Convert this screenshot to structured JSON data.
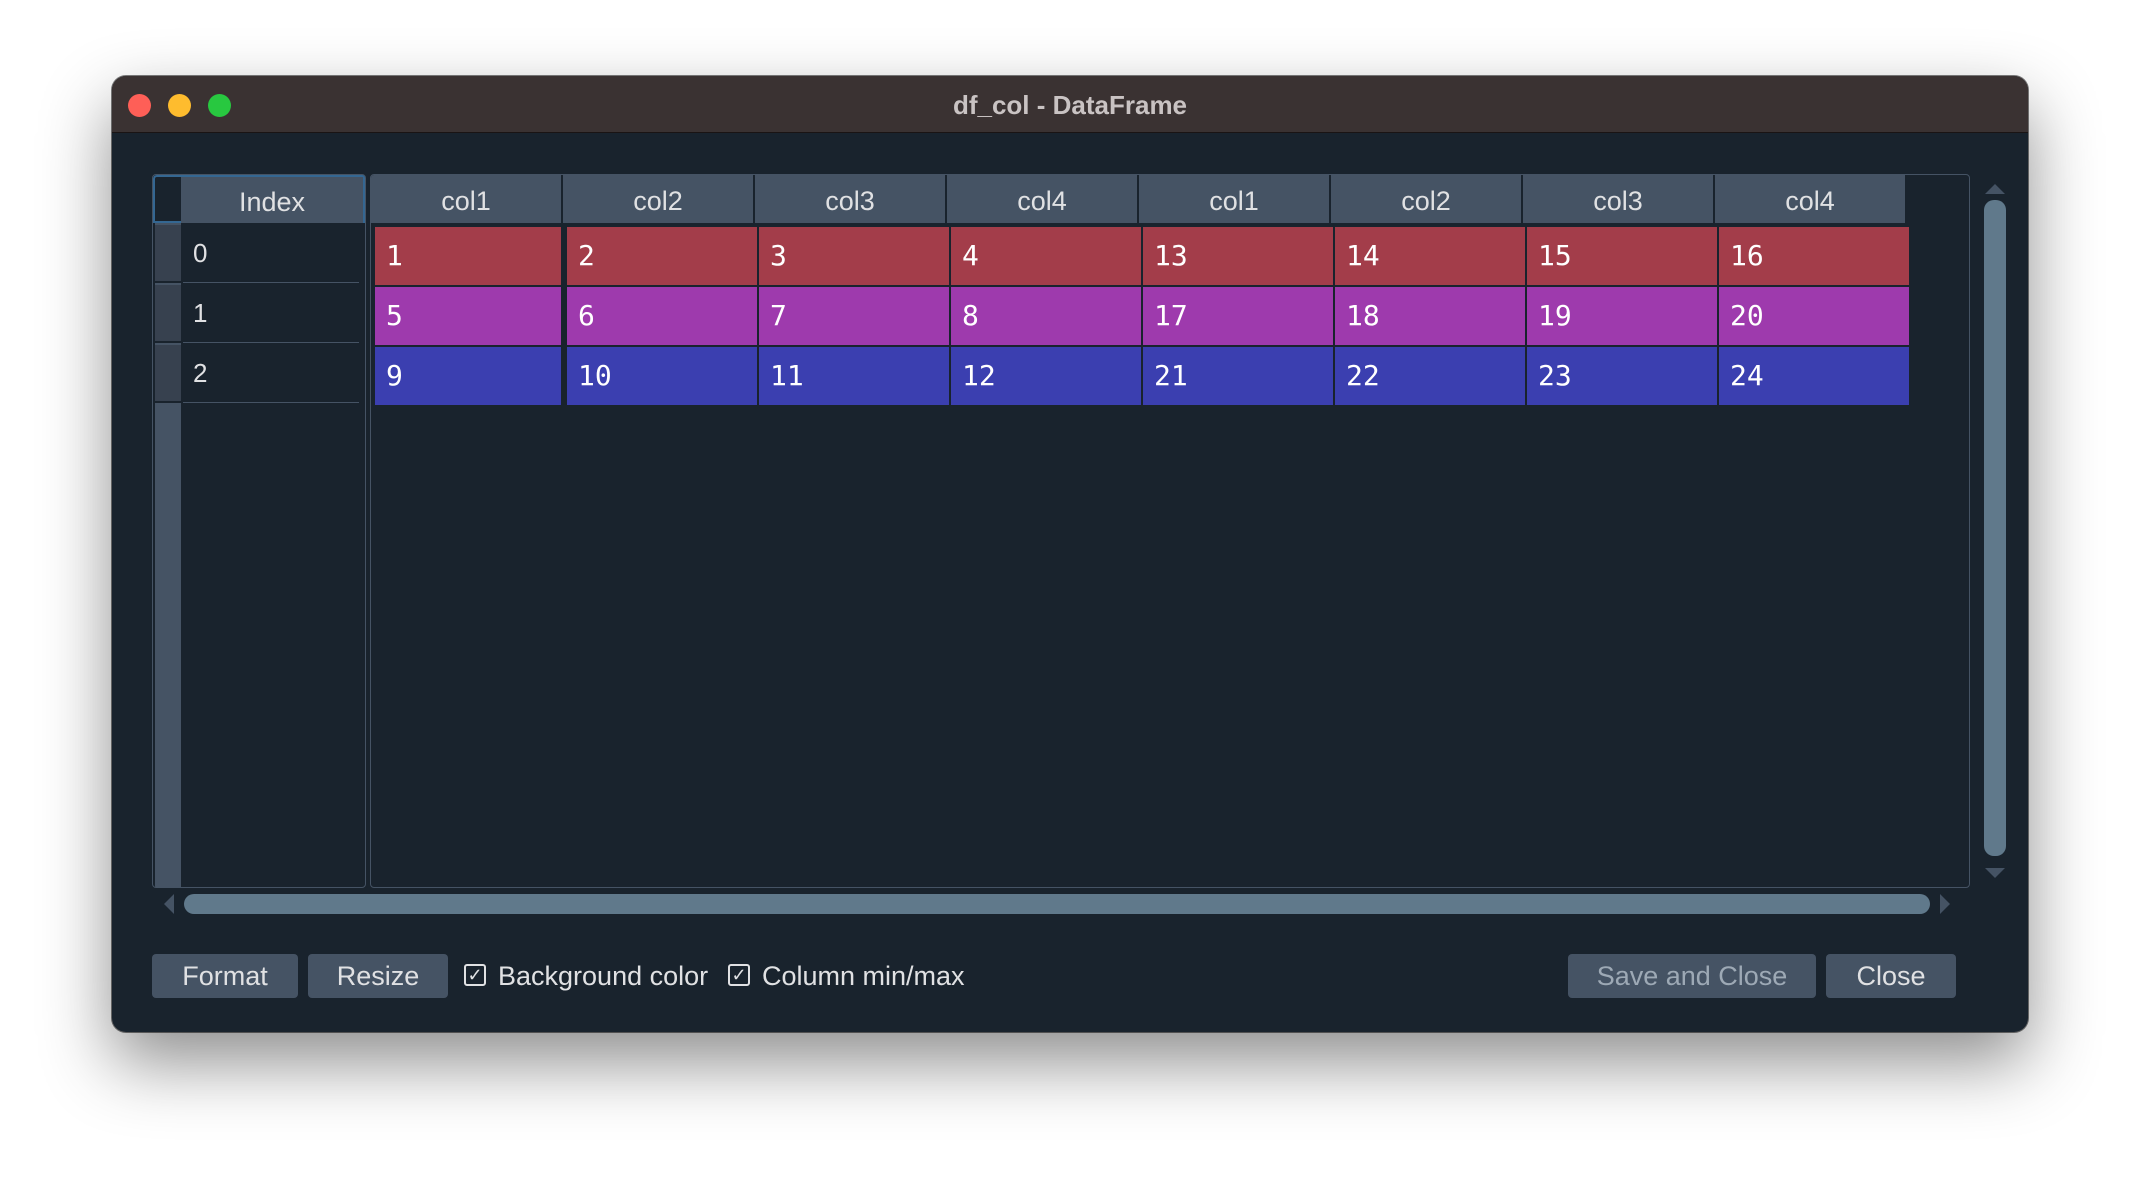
{
  "window": {
    "title": "df_col - DataFrame"
  },
  "table": {
    "index_header": "Index",
    "index": [
      "0",
      "1",
      "2"
    ],
    "columns": [
      "col1",
      "col2",
      "col3",
      "col4",
      "col1",
      "col2",
      "col3",
      "col4"
    ],
    "rows": [
      [
        "1",
        "2",
        "3",
        "4",
        "13",
        "14",
        "15",
        "16"
      ],
      [
        "5",
        "6",
        "7",
        "8",
        "17",
        "18",
        "19",
        "20"
      ],
      [
        "9",
        "10",
        "11",
        "12",
        "21",
        "22",
        "23",
        "24"
      ]
    ],
    "row_colors": [
      "#a33d4a",
      "#9e3aad",
      "#3b3fb0"
    ]
  },
  "buttons": {
    "format": "Format",
    "resize": "Resize",
    "save_and_close": "Save and Close",
    "close": "Close"
  },
  "options": {
    "background_color": {
      "label": "Background color",
      "checked": true
    },
    "column_minmax": {
      "label": "Column min/max",
      "checked": true
    }
  }
}
